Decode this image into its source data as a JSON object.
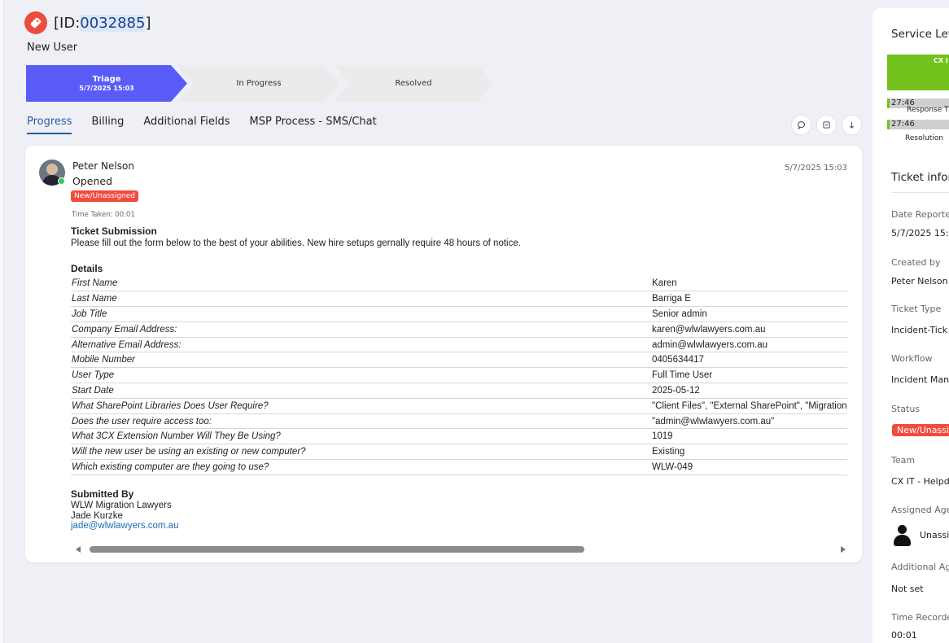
{
  "ticket": {
    "id_prefix": "[ID:",
    "id_number": "0032885",
    "id_suffix": "]",
    "subject": "New User"
  },
  "stages": [
    {
      "name": "Triage",
      "date": "5/7/2025 15:03"
    },
    {
      "name": "In Progress"
    },
    {
      "name": "Resolved"
    }
  ],
  "tabs": [
    "Progress",
    "Billing",
    "Additional Fields",
    "MSP Process - SMS/Chat"
  ],
  "entry": {
    "author": "Peter Nelson",
    "action": "Opened",
    "status": "New/Unassigned",
    "timestamp": "5/7/2025 15:03",
    "time_taken": "Time Taken: 00:01",
    "submission_title": "Ticket Submission",
    "submission_desc": "Please fill out the form below to the best of your abilities. New hire setups gernally require 48 hours of notice.",
    "details_title": "Details",
    "fields": [
      {
        "label": "First Name",
        "value": "Karen"
      },
      {
        "label": "Last Name",
        "value": "Barriga E"
      },
      {
        "label": "Job Title",
        "value": "Senior admin"
      },
      {
        "label": "Company Email Address:",
        "value": "karen@wlwlawyers.com.au"
      },
      {
        "label": "Alternative Email Address:",
        "value": "admin@wlwlawyers.com.au"
      },
      {
        "label": "Mobile Number",
        "value": "0405634417"
      },
      {
        "label": "User Type",
        "value": "Full Time User"
      },
      {
        "label": "Start Date",
        "value": "2025-05-12"
      },
      {
        "label": "What SharePoint Libraries Does User Require?",
        "value": "\"Client Files\", \"External SharePoint\", \"Migration"
      },
      {
        "label": "Does the user require access too:",
        "value": "\"admin@wlwlawyers.com.au\""
      },
      {
        "label": "What 3CX Extension Number Will They Be Using?",
        "value": "1019"
      },
      {
        "label": "Will the new user be using an existing or new computer?",
        "value": "Existing"
      },
      {
        "label": "Which existing computer are they going to use?",
        "value": "WLW-049"
      }
    ],
    "submitted_title": "Submitted By",
    "submitted_company": "WLW Migration Lawyers",
    "submitted_name": "Jade Kurzke",
    "submitted_email": "jade@wlwlawyers.com.au"
  },
  "side": {
    "sla_title": "Service Lev",
    "sla_team": "CX I",
    "response_time": "27:46",
    "response_label": "Response T",
    "resolution_time": "27:46",
    "resolution_label": "Resolution",
    "info_title": "Ticket inform",
    "date_reported_label": "Date Reportec",
    "date_reported": "5/7/2025 15:0",
    "created_by_label": "Created by",
    "created_by": "Peter Nelson",
    "ticket_type_label": "Ticket Type",
    "ticket_type": "Incident-Tick",
    "workflow_label": "Workflow",
    "workflow": "Incident Man",
    "status_label": "Status",
    "status": "New/Unassi",
    "team_label": "Team",
    "team": "CX IT - Helpd",
    "assigned_label": "Assigned Age",
    "assigned": "Unassi",
    "additional_label": "Additional Ag",
    "additional": "Not set",
    "time_recorded_label": "Time Recorde",
    "time_recorded": "00:01"
  },
  "colors": {
    "accent": "#5a5cf8",
    "danger": "#ef4b3f",
    "sla_green": "#73c21e",
    "link": "#1a6bb8"
  }
}
